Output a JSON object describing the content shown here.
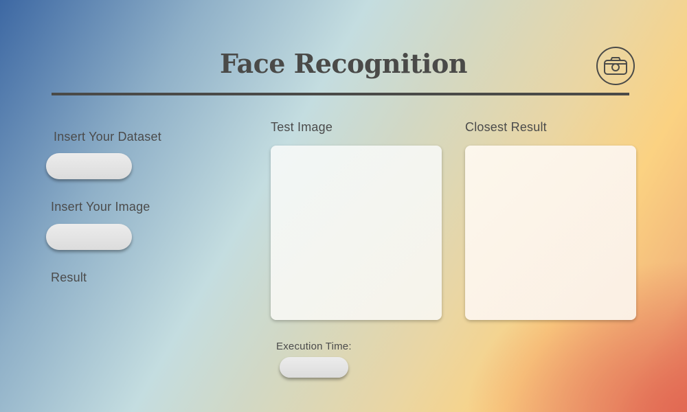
{
  "header": {
    "title": "Face Recognition",
    "camera_icon": "camera-icon"
  },
  "left_panel": {
    "dataset_label": "Insert Your Dataset",
    "image_label": "Insert Your Image",
    "result_label": "Result"
  },
  "test_panel": {
    "label": "Test Image"
  },
  "closest_panel": {
    "label": "Closest Result"
  },
  "execution": {
    "label": "Execution Time:"
  },
  "colors": {
    "text": "#4a4a48",
    "gradient_start": "#3d68a3",
    "gradient_mid": "#c4dde0",
    "gradient_warm": "#fbd282",
    "gradient_end": "#e57d62"
  }
}
